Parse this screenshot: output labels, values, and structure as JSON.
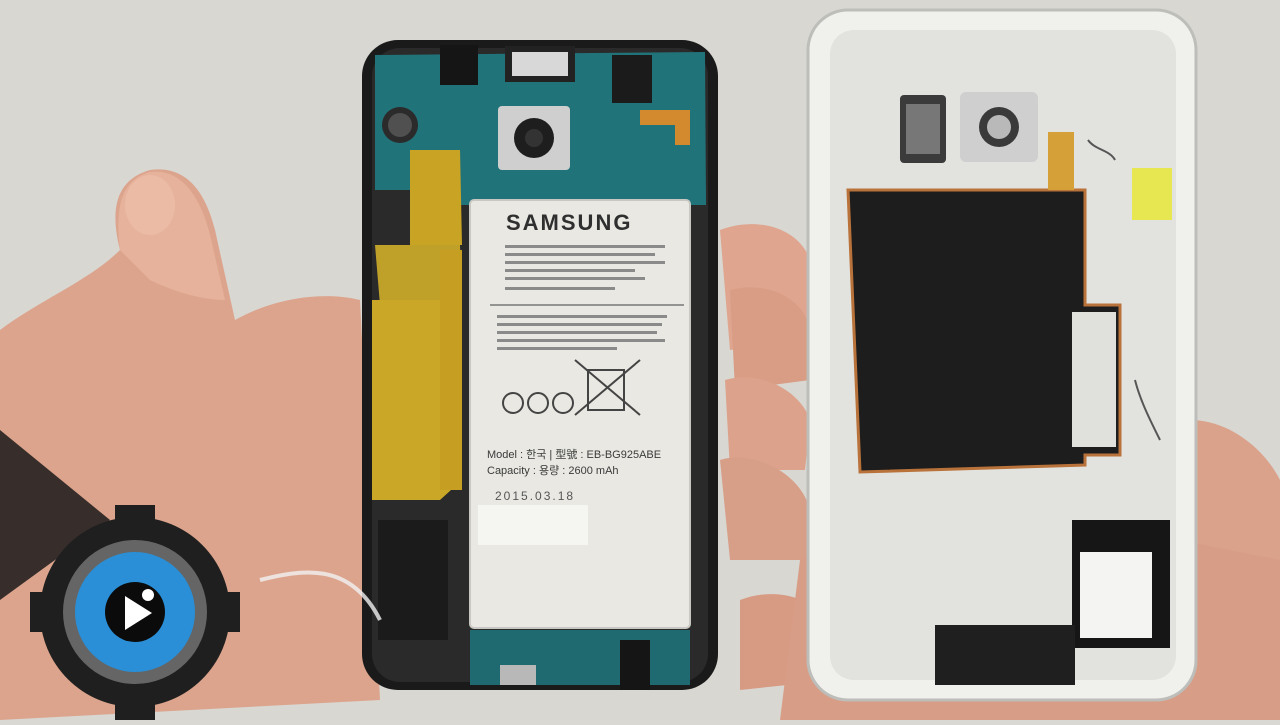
{
  "battery": {
    "brand": "SAMSUNG",
    "model": "Model : 한국 | 型號 : EB-BG925ABE",
    "capacity": "Capacity : 용량 : 2600 mAh",
    "date": "2015.03.18"
  },
  "colors": {
    "background": "#d9d8d3",
    "skin": "#e0a58e",
    "pcb": "#1f6e73",
    "shield": "#c9a324",
    "battery": "#ecebe6",
    "coil": "#1d1d1d",
    "frame": "#e9e9e6",
    "logo_blue": "#2a8fd6"
  },
  "logo": {
    "icon": "gear-eye-play-icon"
  }
}
